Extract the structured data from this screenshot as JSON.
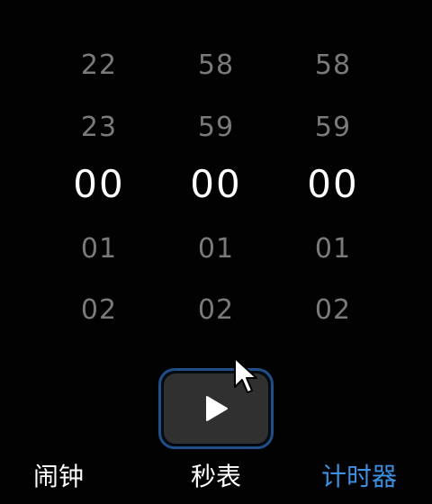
{
  "timer": {
    "hours": {
      "items": [
        "22",
        "23",
        "00",
        "01",
        "02"
      ],
      "selected": "00"
    },
    "minutes": {
      "items": [
        "58",
        "59",
        "00",
        "01",
        "02"
      ],
      "selected": "00"
    },
    "seconds": {
      "items": [
        "58",
        "59",
        "00",
        "01",
        "02"
      ],
      "selected": "00"
    }
  },
  "start_button": {
    "icon": "play-icon"
  },
  "tabs": [
    {
      "label": "闹钟",
      "active": false
    },
    {
      "label": "秒表",
      "active": false
    },
    {
      "label": "计时器",
      "active": true
    }
  ],
  "colors": {
    "background": "#020202",
    "selected_text": "#ffffff",
    "dim_text": "#7a7a7a",
    "accent": "#3d8fe0",
    "button_fill": "#303030",
    "button_border": "#1f4f86"
  },
  "cursor": {
    "icon": "mouse-pointer-icon"
  }
}
